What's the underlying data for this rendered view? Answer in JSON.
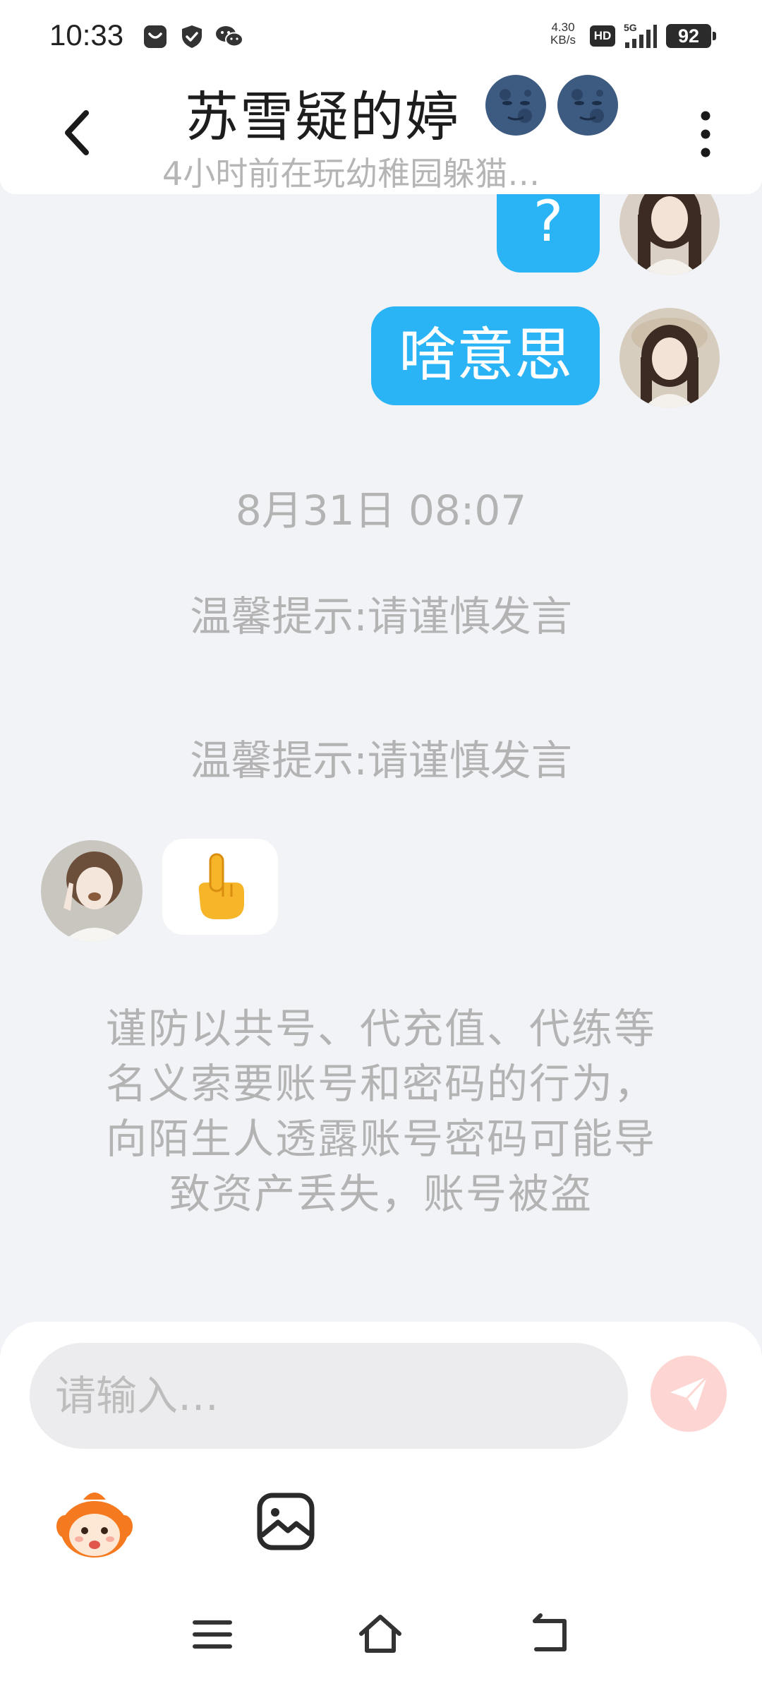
{
  "status_bar": {
    "time": "10:33",
    "net_speed_value": "4.30",
    "net_speed_unit": "KB/s",
    "hd_label": "HD",
    "network_label": "5G",
    "battery": "92",
    "icons": [
      "notification-box-icon",
      "shield-check-icon",
      "wechat-icon",
      "signal-icon",
      "battery-icon"
    ]
  },
  "header": {
    "title": "苏雪疑的婷",
    "title_emojis": [
      "new-moon-face-icon",
      "new-moon-face-icon"
    ],
    "subtitle": "4小时前在玩幼稚园躲猫…"
  },
  "messages": [
    {
      "side": "right",
      "text": "?"
    },
    {
      "side": "right",
      "text": "啥意思"
    }
  ],
  "timestamp": "8月31日 08:07",
  "tips": [
    "温馨提示:请谨慎发言",
    "温馨提示:请谨慎发言"
  ],
  "incoming": {
    "side": "left",
    "content": "pointing-up-hand-emoji"
  },
  "warning": "谨防以共号、代充值、代练等名义索要账号和密码的行为，向陌生人透露账号密码可能导致资产丢失，账号被盗",
  "composer": {
    "placeholder": "请输入…",
    "value": ""
  },
  "colors": {
    "bubble_blue": "#2ab4f6",
    "send_button": "#fdd6d3",
    "muted_text": "#b3b3b3",
    "background": "#f1f3f7"
  }
}
